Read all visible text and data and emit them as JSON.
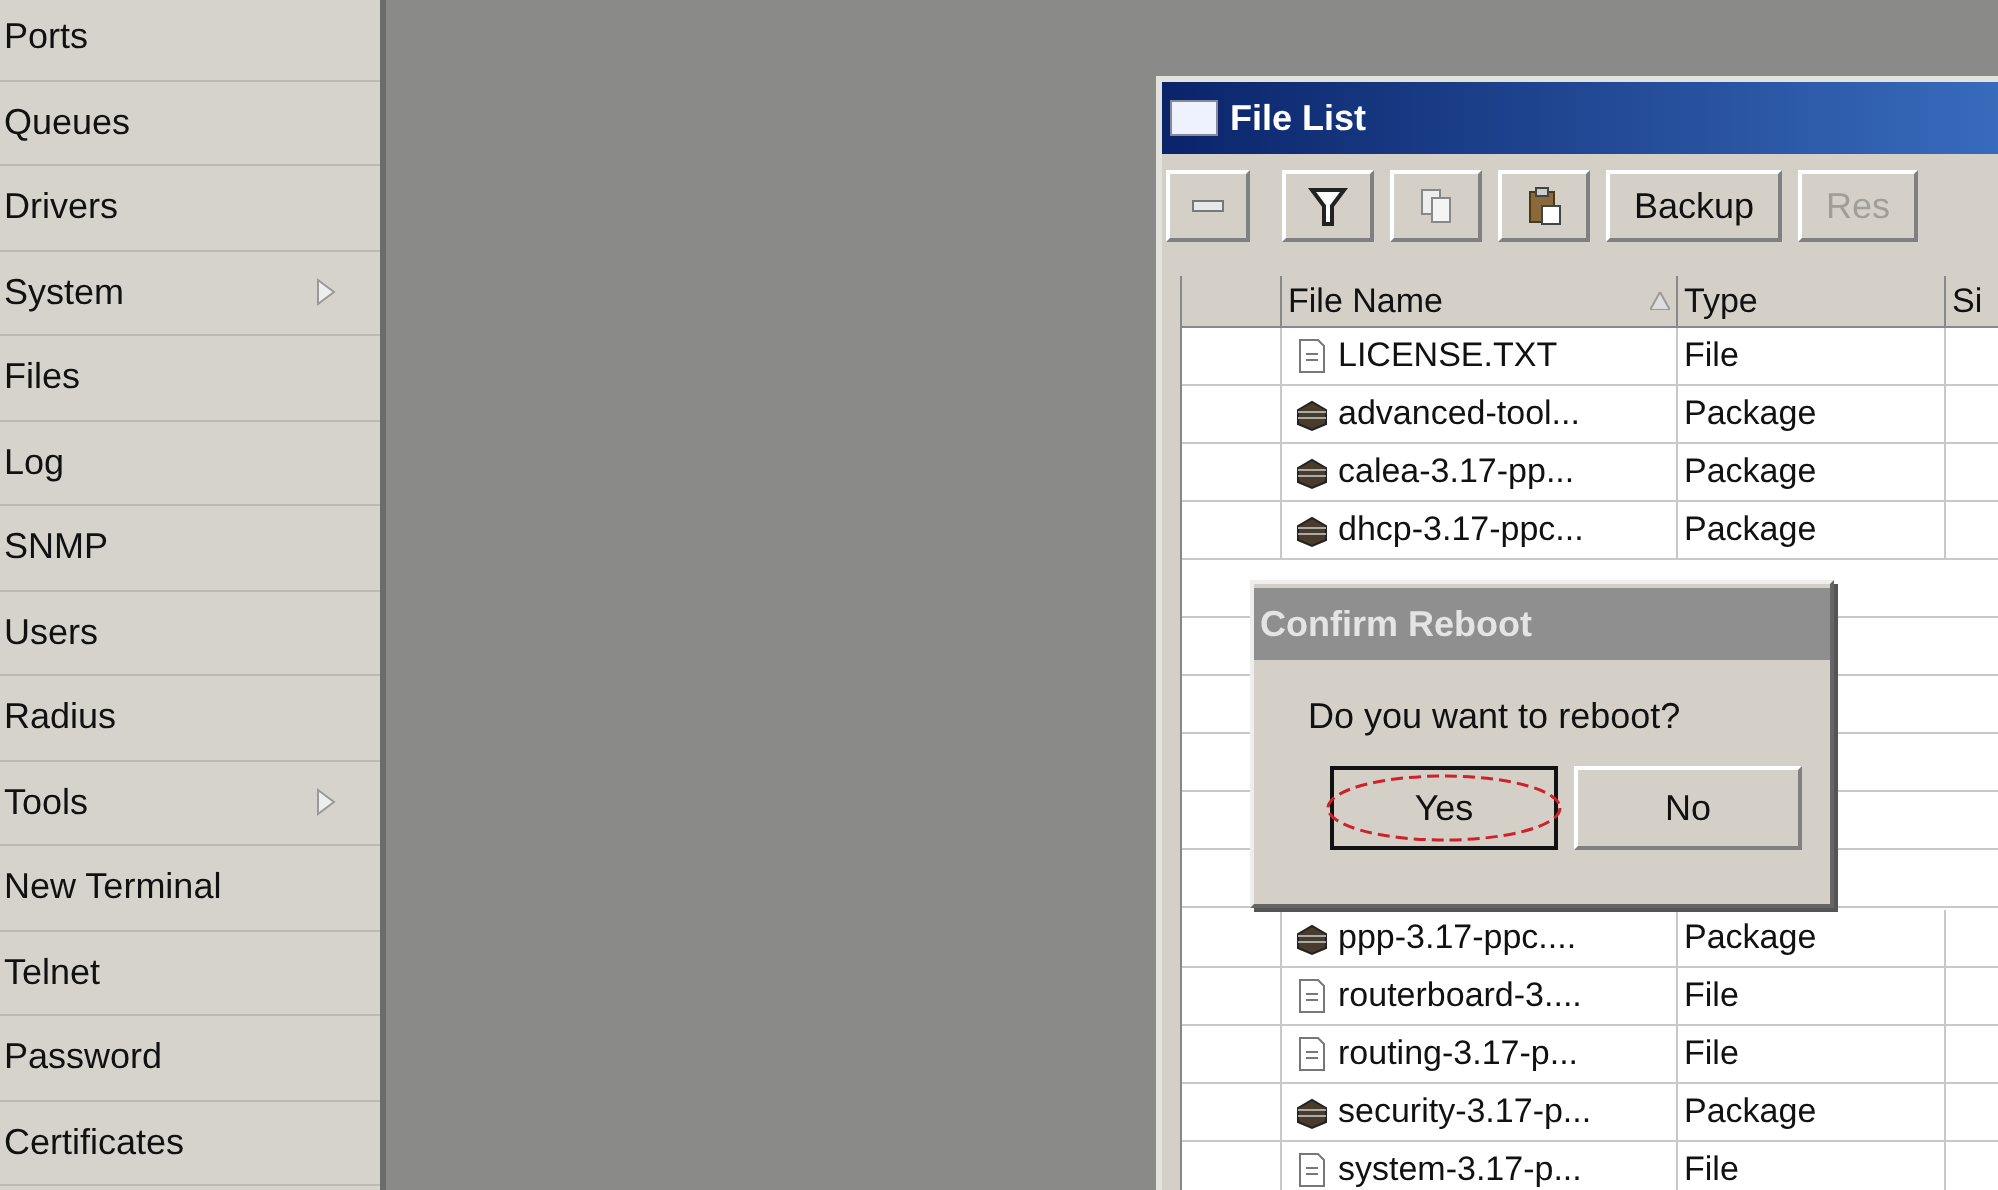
{
  "sidebar": {
    "items": [
      {
        "label": "Ports",
        "submenu": false
      },
      {
        "label": "Queues",
        "submenu": false
      },
      {
        "label": "Drivers",
        "submenu": false
      },
      {
        "label": "System",
        "submenu": true
      },
      {
        "label": "Files",
        "submenu": false
      },
      {
        "label": "Log",
        "submenu": false
      },
      {
        "label": "SNMP",
        "submenu": false
      },
      {
        "label": "Users",
        "submenu": false
      },
      {
        "label": "Radius",
        "submenu": false
      },
      {
        "label": "Tools",
        "submenu": true
      },
      {
        "label": "New Terminal",
        "submenu": false
      },
      {
        "label": "Telnet",
        "submenu": false
      },
      {
        "label": "Password",
        "submenu": false
      },
      {
        "label": "Certificates",
        "submenu": false
      }
    ]
  },
  "window": {
    "title": "File List",
    "toolbar": [
      {
        "kind": "remove"
      },
      {
        "kind": "filter"
      },
      {
        "kind": "copy"
      },
      {
        "kind": "paste"
      },
      {
        "kind": "text",
        "label": "Backup",
        "disabled": false
      },
      {
        "kind": "text",
        "label": "Res",
        "disabled": true
      }
    ],
    "table": {
      "columns": [
        {
          "label": "File Name",
          "sorted": true
        },
        {
          "label": "Type"
        },
        {
          "label": "Si"
        }
      ],
      "rows": [
        {
          "kind": "file",
          "name": "LICENSE.TXT",
          "type": "File"
        },
        {
          "kind": "package",
          "name": "advanced-tool...",
          "type": "Package"
        },
        {
          "kind": "package",
          "name": "calea-3.17-pp...",
          "type": "Package"
        },
        {
          "kind": "package",
          "name": "dhcp-3.17-ppc...",
          "type": "Package"
        },
        {
          "kind": "package",
          "name": "ppp-3.17-ppc....",
          "type": "Package"
        },
        {
          "kind": "file",
          "name": "routerboard-3....",
          "type": "File"
        },
        {
          "kind": "file",
          "name": "routing-3.17-p...",
          "type": "File"
        },
        {
          "kind": "package",
          "name": "security-3.17-p...",
          "type": "Package"
        },
        {
          "kind": "file",
          "name": "system-3.17-p...",
          "type": "File"
        }
      ]
    }
  },
  "dialog": {
    "title": "Confirm Reboot",
    "message": "Do you want to reboot?",
    "buttons": [
      {
        "label": "Yes",
        "focused": true,
        "highlighted": true
      },
      {
        "label": "No",
        "focused": false,
        "highlighted": false
      }
    ]
  }
}
